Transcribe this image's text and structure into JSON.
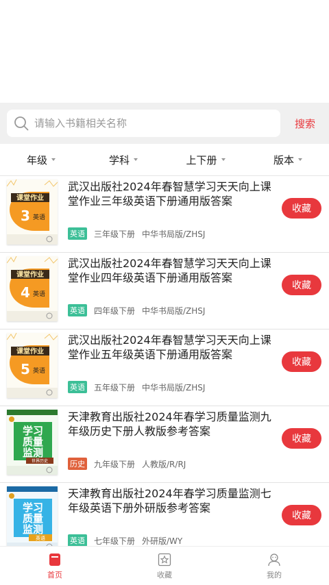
{
  "search": {
    "placeholder": "请输入书籍相关名称",
    "button_label": "搜索"
  },
  "filters": [
    "年级",
    "学科",
    "上下册",
    "版本"
  ],
  "books": [
    {
      "title": "武汉出版社2024年春智慧学习天天向上课堂作业三年级英语下册通用版答案",
      "subject": "英语",
      "subject_color": "#3cbf97",
      "grade": "三年级下册",
      "edition": "中华书局版/ZHSJ",
      "favorite_label": "收藏",
      "cover": {
        "series": "课堂作业",
        "number": "3",
        "subject": "英语",
        "style": "orange"
      }
    },
    {
      "title": "武汉出版社2024年春智慧学习天天向上课堂作业四年级英语下册通用版答案",
      "subject": "英语",
      "subject_color": "#3cbf97",
      "grade": "四年级下册",
      "edition": "中华书局版/ZHSJ",
      "favorite_label": "收藏",
      "cover": {
        "series": "课堂作业",
        "number": "4",
        "subject": "英语",
        "style": "orange"
      }
    },
    {
      "title": "武汉出版社2024年春智慧学习天天向上课堂作业五年级英语下册通用版答案",
      "subject": "英语",
      "subject_color": "#3cbf97",
      "grade": "五年级下册",
      "edition": "中华书局版/ZHSJ",
      "favorite_label": "收藏",
      "cover": {
        "series": "课堂作业",
        "number": "5",
        "subject": "英语",
        "style": "orange"
      }
    },
    {
      "title": "天津教育出版社2024年春学习质量监测九年级历史下册人教版参考答案",
      "subject": "历史",
      "subject_color": "#e0613c",
      "grade": "九年级下册",
      "edition": "人教版/R/RJ",
      "favorite_label": "收藏",
      "cover": {
        "series": "学习质量监测",
        "number": "",
        "subject": "世界历史",
        "style": "green"
      }
    },
    {
      "title": "天津教育出版社2024年春学习质量监测七年级英语下册外研版参考答案",
      "subject": "英语",
      "subject_color": "#3cbf97",
      "grade": "七年级下册",
      "edition": "外研版/WY",
      "favorite_label": "收藏",
      "cover": {
        "series": "学习质量监测",
        "number": "",
        "subject": "英语",
        "style": "blue"
      }
    }
  ],
  "tabbar": [
    {
      "label": "首页",
      "icon": "book-icon",
      "active": true
    },
    {
      "label": "收藏",
      "icon": "star-icon",
      "active": false
    },
    {
      "label": "我的",
      "icon": "user-icon",
      "active": false
    }
  ],
  "colors": {
    "accent": "#e8373c",
    "favorite_button": "#e8383d"
  }
}
